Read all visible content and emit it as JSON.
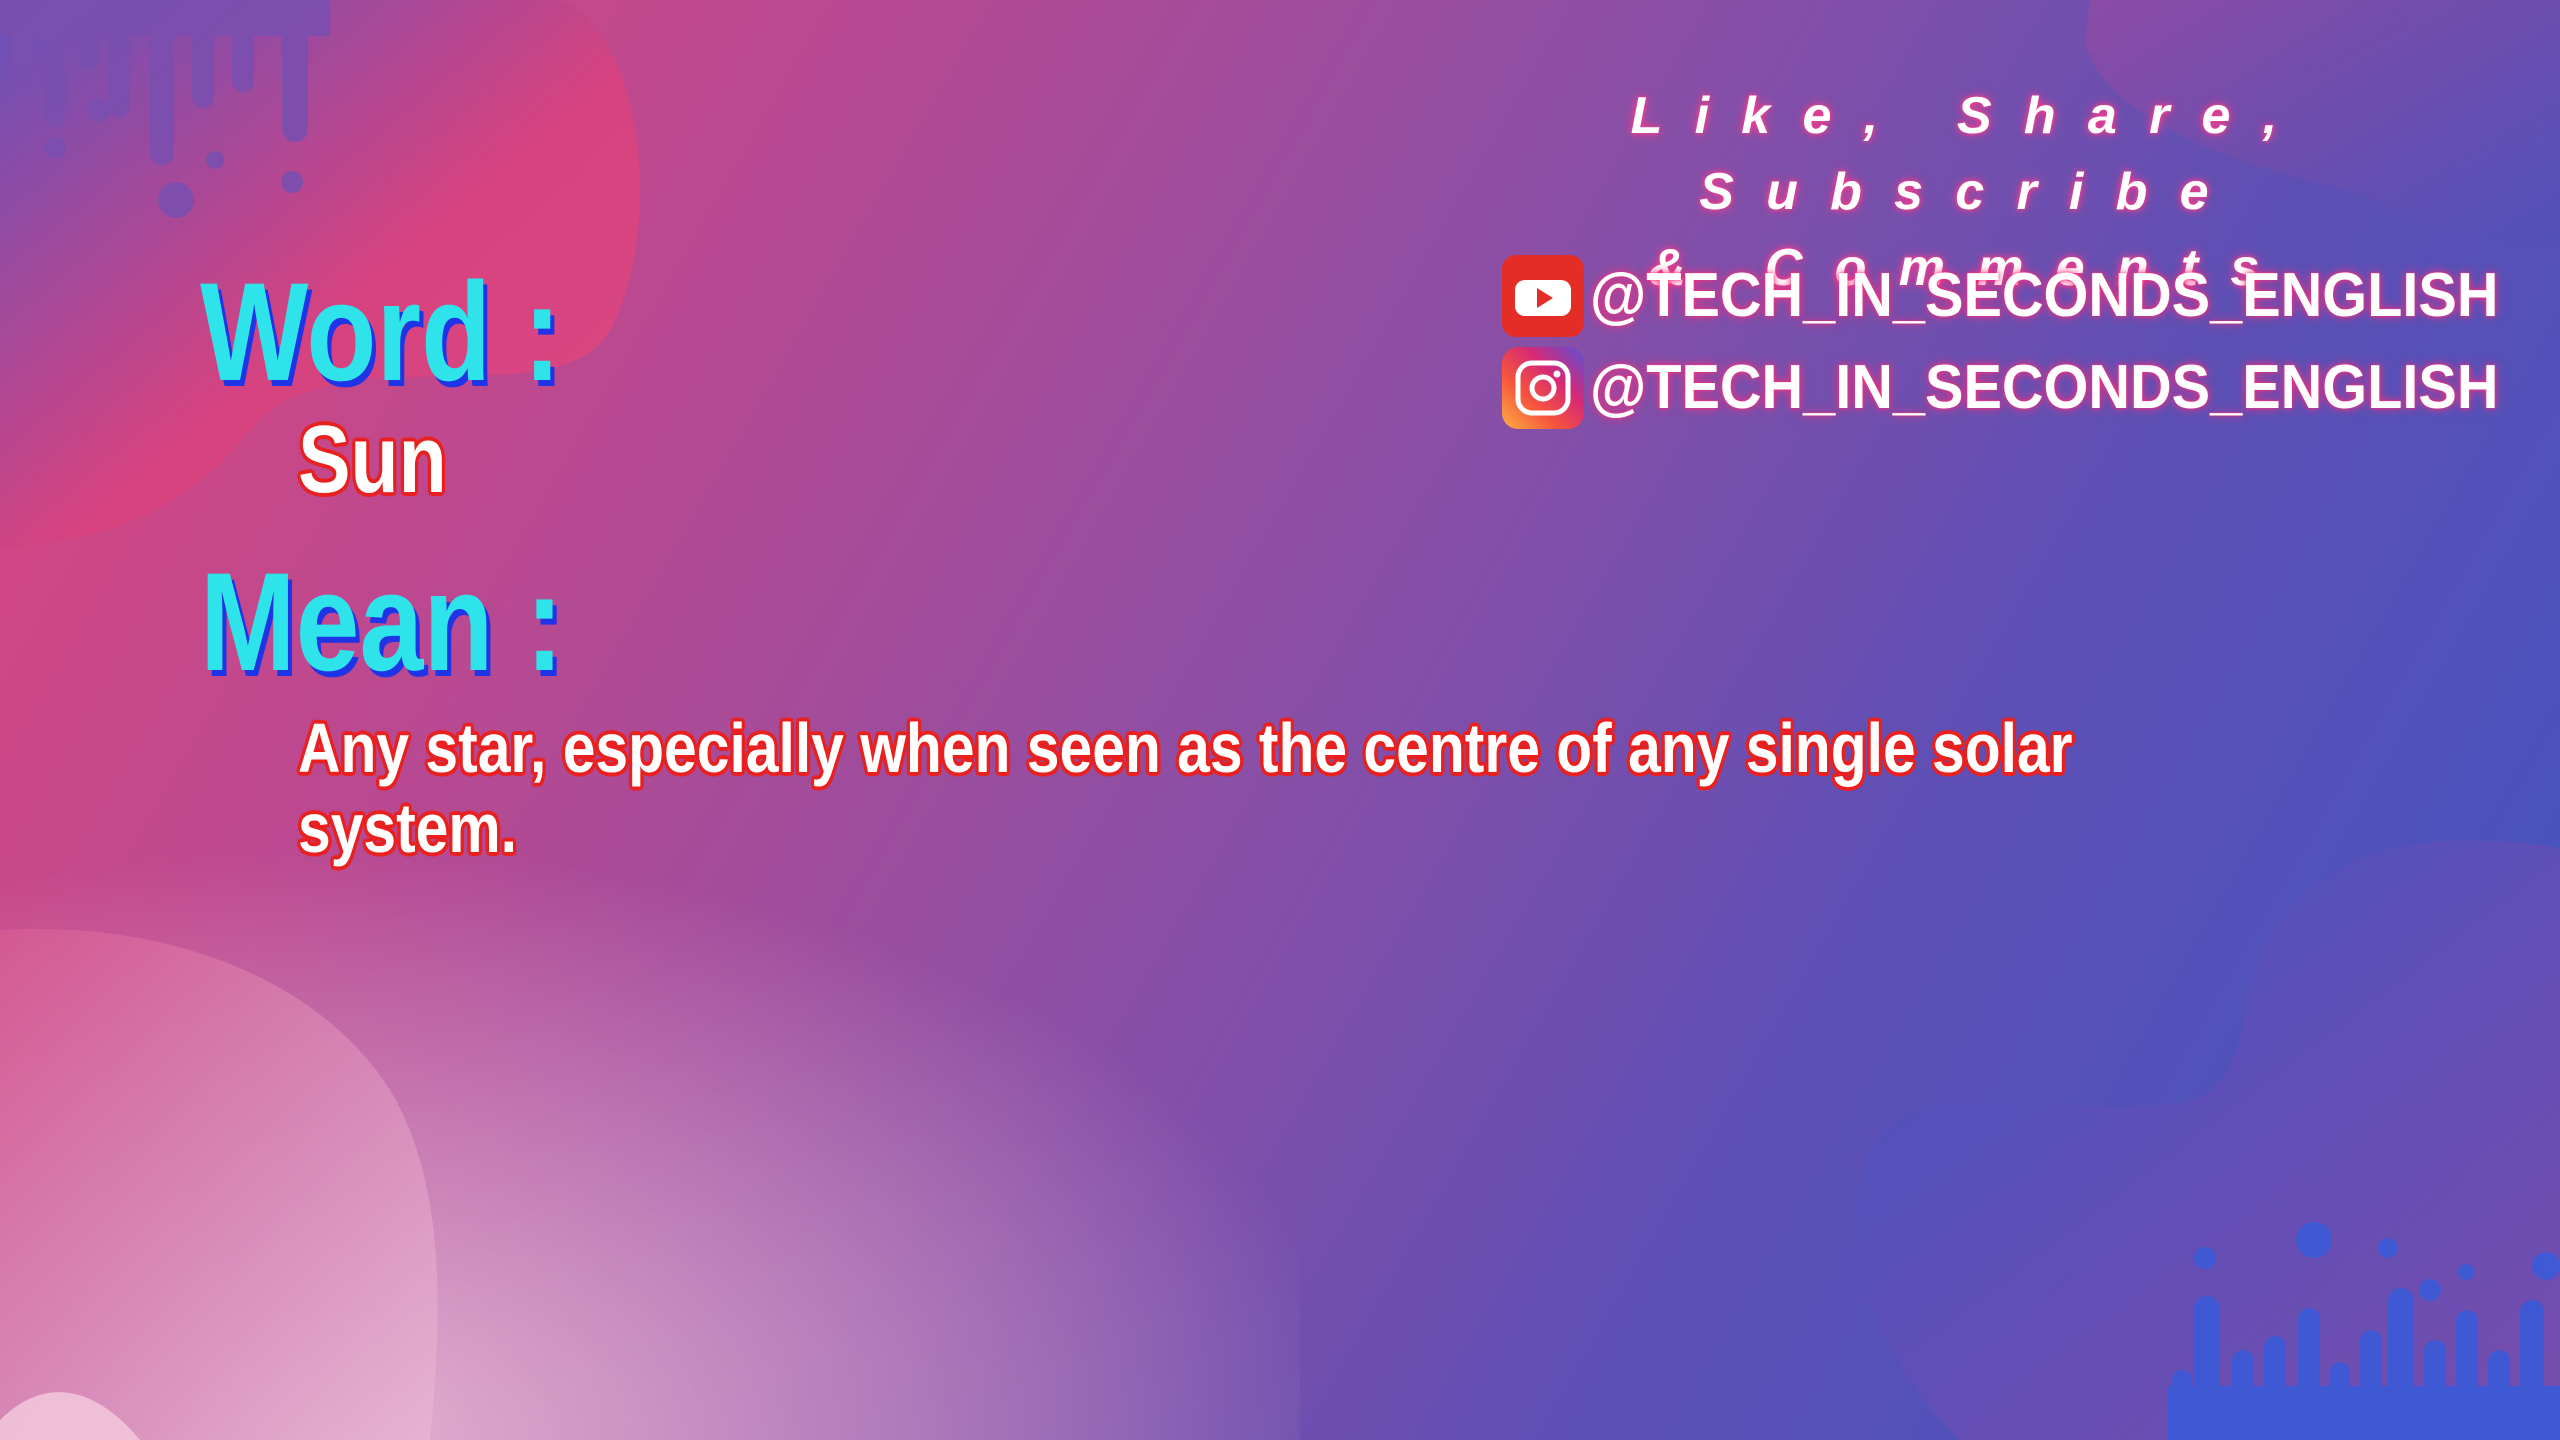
{
  "cta": {
    "line1": "Like, Share, Subscribe",
    "line2": "& Comments"
  },
  "social": {
    "youtube": {
      "icon": "youtube-icon",
      "handle": "@TECH_IN_SECONDS_ENGLISH"
    },
    "instagram": {
      "icon": "instagram-icon",
      "handle": "@TECH_IN_SECONDS_ENGLISH"
    }
  },
  "word": {
    "heading": "Word :",
    "value": "Sun"
  },
  "meaning": {
    "heading": "Mean :",
    "value": "Any star, especially when seen as the centre of any single solar system."
  },
  "colors": {
    "heading": "#2fe3ea",
    "heading_shadow": "#1f34e6",
    "value_text": "#ffffff",
    "value_outline": "#e8201f",
    "youtube_red": "#e52d27",
    "glow": "#ff2d7a"
  }
}
